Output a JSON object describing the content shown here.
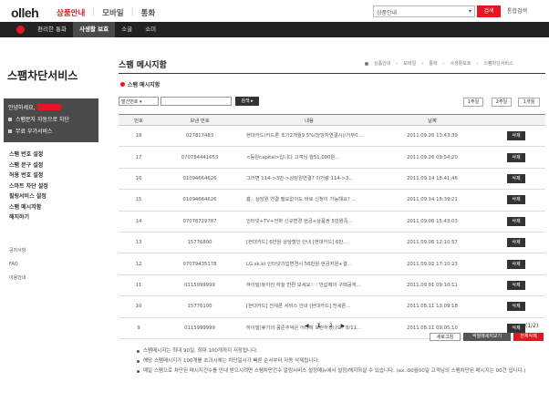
{
  "header": {
    "logo": "olleh",
    "nav": [
      "상품안내",
      "모바일",
      "통화"
    ],
    "search_select": "상품안내",
    "search_button": "검색",
    "search_all": "통합검색"
  },
  "gnb": {
    "items": [
      "편리한 통화",
      "사생활 보호",
      "소굴",
      "쇼미"
    ],
    "active": 1
  },
  "sidebar": {
    "title": "스팸차단서비스",
    "greeting": "안녕하세요,",
    "box_items": [
      "스팸문자 자동으로 차단",
      "무료 부가서비스"
    ],
    "menu": [
      "스팸 번호 설정",
      "스팸 문구 설정",
      "허용 번호 설정",
      "스마트 차단 설정",
      "필링서비스 설정",
      "스팸 메시지함",
      "해지하기"
    ],
    "sub": [
      "공지사항",
      "FAQ",
      "이용안내"
    ]
  },
  "main": {
    "title": "스팸 메시지함",
    "breadcrumb": [
      "상품안내",
      "모바일",
      "통화",
      "사생활보호",
      "스팸차단서비스"
    ],
    "section": "스팸 메시지함",
    "filter_select": "발신번호",
    "filter_button": "검색",
    "range_buttons": [
      "1주일",
      "2주일",
      "1개월"
    ]
  },
  "table": {
    "headers": [
      "번호",
      "보낸 번호",
      "내용",
      "날짜",
      ""
    ],
    "rows": [
      {
        "no": "18",
        "from": "027817483",
        "content": "현대카드)카드론 조기2개월9.5%(당당자연결시)/거부0...",
        "date": "2011.09.26 13:43:39",
        "action": "삭제"
      },
      {
        "no": "17",
        "from": "070784441653",
        "content": "<동원capital>입니다 고객님 월51,000원...",
        "date": "2011.09.26 09:54:20",
        "action": "삭제"
      },
      {
        "no": "16",
        "from": "01094664626",
        "content": "그러면 114->3번->상담원연결? 이거랑 114->3...",
        "date": "2011.09.14 18:41:46",
        "action": "삭제"
      },
      {
        "no": "15",
        "from": "01094664626",
        "content": "흠.. 상담원 연결 필요없이도 바로 신청이 가능해요? ...",
        "date": "2011.09.14 18:39:21",
        "action": "삭제"
      },
      {
        "no": "14",
        "from": "07078729787",
        "content": "인터넷+TV+전화 신규변경 현금+상품권 5만원즉...",
        "date": "2011.09.06 15:43:03",
        "action": "삭제"
      },
      {
        "no": "13",
        "from": "15776800",
        "content": "[현대카드] 6만원 상당할인 안내 [현대카드] 6만...",
        "date": "2011.09.06 12:10:57",
        "action": "삭제"
      },
      {
        "no": "12",
        "from": "07079435178",
        "content": "LG.sk.kt 인터넷가입변경시 56만원 현금지원+결...",
        "date": "2011.09.02 17:10:23",
        "action": "삭제"
      },
      {
        "no": "11",
        "from": "0115999999",
        "content": "하이밀)놓아진 하늘 반편 보세요♡♡반값메이 구매공개...",
        "date": "2011.09.01 09:10:11",
        "action": "삭제"
      },
      {
        "no": "10",
        "from": "15776100",
        "content": "[현대카드] 전세론 서비스 안내 [현대카드] 전세론...",
        "date": "2011.08.11 13:09:18",
        "action": "삭제"
      },
      {
        "no": "9",
        "from": "0115999999",
        "content": "하이밀)휴가의 뭉준추억은 어디에 보관하셨나요? 8/11...",
        "date": "2011.08.11 09:05:10",
        "action": "삭제"
      }
    ]
  },
  "pager": {
    "prev": "◀",
    "pages": [
      "1",
      "2"
    ],
    "next": "▶",
    "count": "(1/2)"
  },
  "actions": [
    "새로고침",
    "씩씰메세지보기",
    "전체삭제"
  ],
  "notes": [
    "스팸메시지는 최대 90일, 최대 100개까지 저장됩니다.",
    "해당 스팸메시지가 100개를 초과시에는 차단일시가 빠른 순서부터 자동 삭제됩니다.",
    "매일 스팸으로 차단된 메시지건수를 안내 받으시려면 스팸차단건수 알림서비스 설정메뉴에서 설정/해지하실 수 있습니다. (ex. 00월00일 고객님의 스팸차단된 메시지는 00건 입니다.)"
  ],
  "colors": {
    "accent": "#e8141f",
    "dark": "#222222"
  }
}
